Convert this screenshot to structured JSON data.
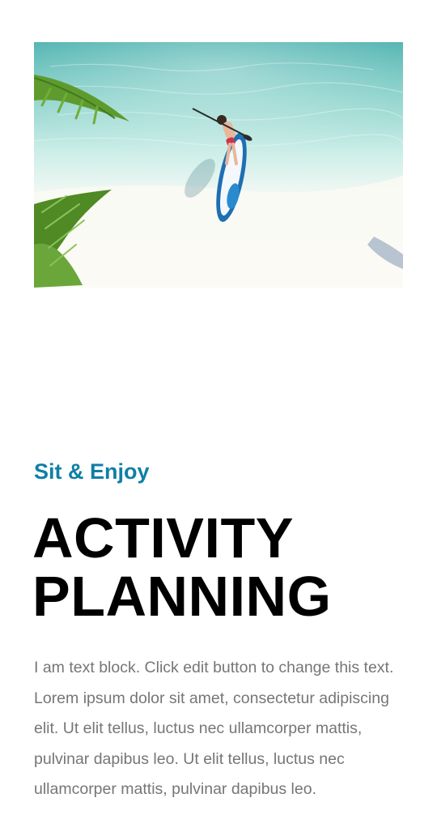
{
  "hero_image": {
    "alt": ""
  },
  "section": {
    "subtitle": "Sit & Enjoy",
    "title_line1": "ACTIVITY",
    "title_line2": "PLANNING",
    "body": "I am text block. Click edit button to change this text. Lorem ipsum dolor sit amet, consectetur adipiscing elit. Ut elit tellus, luctus nec ullamcorper mattis, pulvinar dapibus leo. Ut elit tellus, luctus nec ullamcorper mattis, pulvinar dapibus leo."
  },
  "colors": {
    "accent": "#0f7fa6",
    "heading": "#000000",
    "body_text": "#767676",
    "background": "#ffffff"
  }
}
